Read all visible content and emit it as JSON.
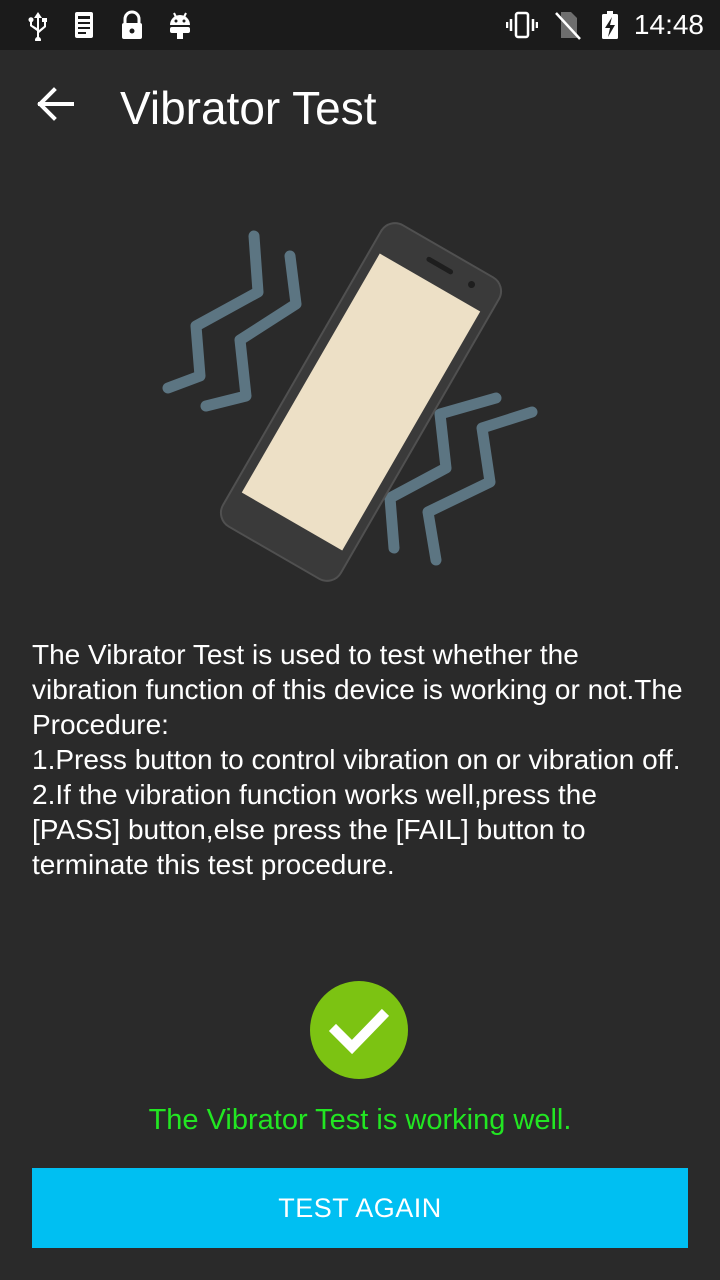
{
  "status_bar": {
    "time": "14:48",
    "left_icons": [
      "usb-icon",
      "log-icon",
      "lock-icon",
      "android-icon"
    ],
    "right_icons": [
      "vibrate-icon",
      "no-sim-icon",
      "battery-charging-icon"
    ]
  },
  "app_bar": {
    "back_icon": "arrow-back-icon",
    "title": "Vibrator Test"
  },
  "illustration": {
    "icon": "vibrating-phone-illustration",
    "colors": {
      "wave": "#5c7582",
      "phone_body": "#3a3a3a",
      "screen": "#ede0c6"
    }
  },
  "description": {
    "line1": "The Vibrator Test is used to test whether the vibration function of this device is working or not.The Procedure:",
    "line2": "1.Press button to control vibration on or vibration off.",
    "line3": "2.If the vibration function works well,press the [PASS] button,else press the [FAIL] button to terminate this test procedure."
  },
  "result": {
    "icon": "check-circle-icon",
    "text": "The Vibrator Test is working well.",
    "color": "#22e622",
    "icon_color": "#7cc312"
  },
  "button": {
    "label": "TEST AGAIN",
    "color": "#00bff2"
  }
}
